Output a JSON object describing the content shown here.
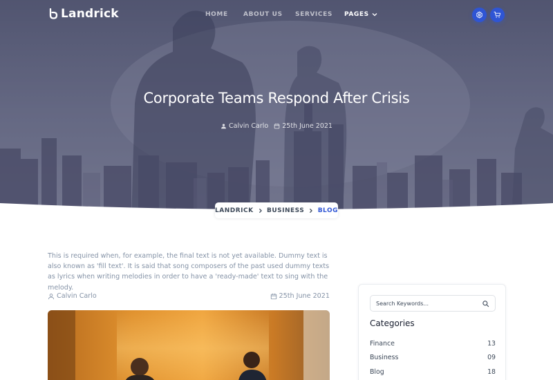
{
  "brand": {
    "name": "Landrick"
  },
  "nav": {
    "items": [
      {
        "label": "HOME"
      },
      {
        "label": "ABOUT US"
      },
      {
        "label": "SERVICES"
      },
      {
        "label": "PAGES"
      }
    ],
    "accent_color": "#2f55d4"
  },
  "hero": {
    "title": "Corporate Teams Respond After Crisis",
    "author": "Calvin Carlo",
    "date": "25th June 2021"
  },
  "breadcrumb": {
    "items": [
      {
        "label": "LANDRICK"
      },
      {
        "label": "BUSINESS"
      },
      {
        "label": "BLOG"
      }
    ]
  },
  "post": {
    "intro": "This is required when, for example, the final text is not yet available. Dummy text is also known as 'fill text'. It is said that song composers of the past used dummy texts as lyrics when writing melodies in order to have a 'ready-made' text to sing with the melody.",
    "author": "Calvin Carlo",
    "date": "25th June 2021"
  },
  "sidebar": {
    "search_placeholder": "Search Keywords...",
    "categories_title": "Categories",
    "categories": [
      {
        "name": "Finance",
        "count": "13"
      },
      {
        "name": "Business",
        "count": "09"
      },
      {
        "name": "Blog",
        "count": "18"
      }
    ]
  }
}
